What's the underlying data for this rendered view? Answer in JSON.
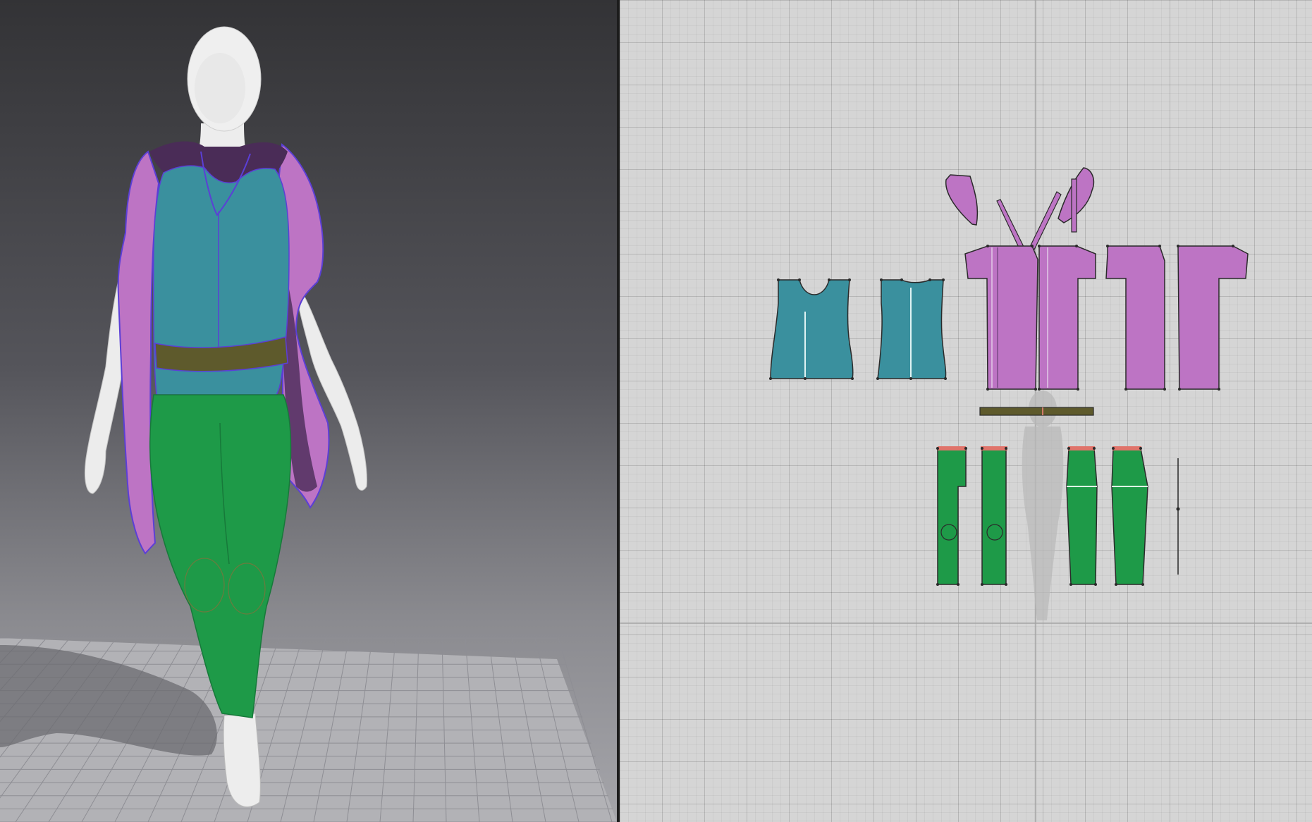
{
  "app": {
    "views": [
      "3d-garment-window",
      "2d-pattern-window"
    ]
  },
  "colors": {
    "shirt": "#3a909e",
    "jacket": "#bd74c4",
    "pants": "#1e9a48",
    "belt": "#5e5a2c",
    "avatar": "#ececec",
    "stitch": "#5b3fd6",
    "waistband": "#e0736a",
    "outline": "#2a2a2a"
  },
  "garments": [
    {
      "name": "shirt",
      "color": "teal"
    },
    {
      "name": "jacket",
      "color": "purple"
    },
    {
      "name": "pants",
      "color": "green"
    },
    {
      "name": "belt",
      "color": "olive"
    }
  ]
}
